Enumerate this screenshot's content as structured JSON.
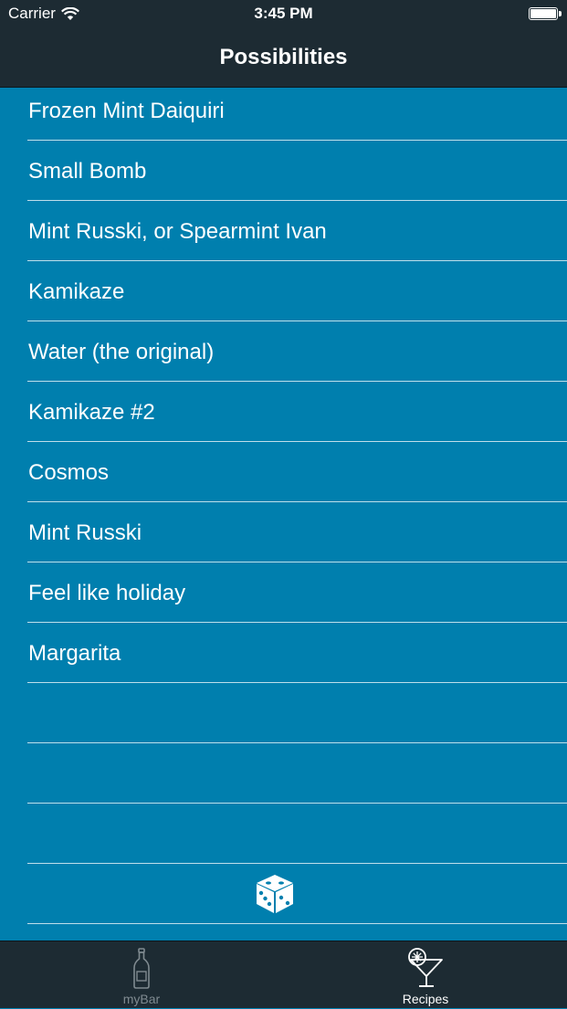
{
  "status_bar": {
    "carrier": "Carrier",
    "time": "3:45 PM",
    "wifi_icon": "wifi-icon",
    "battery_icon": "battery-icon"
  },
  "nav": {
    "title": "Possibilities"
  },
  "list": {
    "items": [
      {
        "label": "Frozen Mint Daiquiri"
      },
      {
        "label": "Small Bomb"
      },
      {
        "label": "Mint Russki, or Spearmint Ivan"
      },
      {
        "label": "Kamikaze"
      },
      {
        "label": "Water (the original)"
      },
      {
        "label": "Kamikaze #2"
      },
      {
        "label": "Cosmos"
      },
      {
        "label": "Mint Russki"
      },
      {
        "label": "Feel like holiday"
      },
      {
        "label": "Margarita"
      }
    ],
    "random_icon": "dice-icon"
  },
  "tabs": [
    {
      "label": "myBar",
      "icon": "bottle-icon",
      "active": false
    },
    {
      "label": "Recipes",
      "icon": "cocktail-glass-icon",
      "active": true
    }
  ],
  "colors": {
    "bar_background": "#1d2b33",
    "list_background": "#007fae",
    "inactive_tab": "#7f8a90",
    "text": "#ffffff"
  }
}
